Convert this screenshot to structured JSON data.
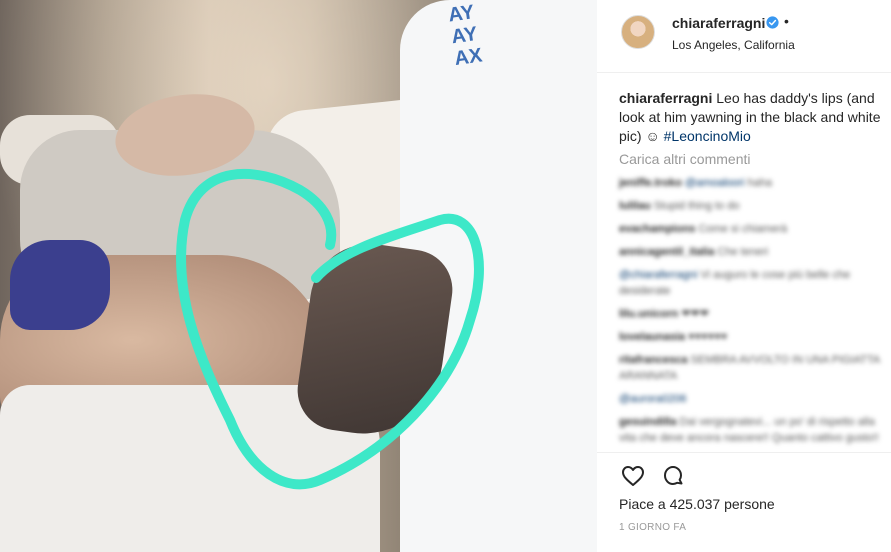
{
  "post": {
    "username": "chiaraferragni",
    "dot": "•",
    "location": "Los Angeles, California",
    "caption_user": "chiaraferragni",
    "caption_text": " Leo has daddy's lips (and look at him yawning in the black and white pic) ",
    "caption_emoji": "☺",
    "caption_tag": "#LeoncinoMio",
    "load_more": "Carica altri commenti",
    "likes": "Piace a 425.037 persone",
    "time": "1 GIORNO FA",
    "shirt_text": "AY\nAY\nAX"
  },
  "comments": [
    {
      "user": "jeniffe.troko",
      "mention": "@amoaloori",
      "text": " haha"
    },
    {
      "user": "lulilau",
      "mention": "",
      "text": " Stupid thing to do"
    },
    {
      "user": "evachampions",
      "mention": "",
      "text": " Come si chiamerà"
    },
    {
      "user": "annicagentil_italia",
      "mention": "",
      "text": " Che teneri"
    },
    {
      "user": "",
      "mention": "@chiaraferragni",
      "text": " Vi auguro le cose più belle che desiderate"
    },
    {
      "user": "lilu.unicorn",
      "mention": "",
      "text": " ❤❤❤"
    },
    {
      "user": "lovelaunasia",
      "mention": "",
      "text": " ♥♥♥♥♥♥"
    },
    {
      "user": "ritafrancesca",
      "mention": "",
      "text": " SEMBRA AVVOLTO IN UNA PIGIATTA ARANNATA "
    },
    {
      "user": "",
      "mention": "@aurora0206",
      "text": ""
    },
    {
      "user": "gesuindilla",
      "mention": "",
      "text": " Dai vergognatevi... un po' di rispetto alla vita che deve ancora nascere!! Quanto cattivo gusto!!"
    }
  ],
  "colors": {
    "heart": "#3de8c8",
    "tag": "#003569",
    "verified": "#3897f0"
  },
  "icons": [
    "verified-icon",
    "heart-icon",
    "comment-icon"
  ]
}
